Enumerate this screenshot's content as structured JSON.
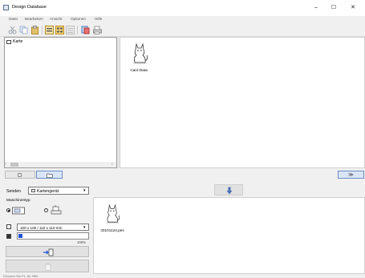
{
  "window": {
    "title": "Design Database",
    "minimize_glyph": "–",
    "maximize_glyph": "☐",
    "close_glyph": "✕"
  },
  "menu": [
    "Datei",
    "Bearbeiten",
    "Ansicht",
    "Optionen",
    "Hilfe"
  ],
  "toolbar": {
    "icons": [
      "cut-icon",
      "copy-icon",
      "paste-icon",
      "large-icons-view-icon",
      "small-icons-view-icon",
      "list-view-icon",
      "design-library-icon",
      "print-icon"
    ]
  },
  "tree": {
    "items": [
      {
        "label": "Karte"
      }
    ]
  },
  "designs": [
    {
      "label": "Card Data",
      "icon": "cat-design-icon"
    }
  ],
  "tabs": {
    "collapse_glyph": "≫"
  },
  "send": {
    "label": "Senden",
    "device_value": "Kartengerät",
    "machine_type_label": "Maschinentyp",
    "frame_size_value": "100 x 100 / 110 x 110 mm",
    "progress_value": 0.06,
    "progress_label": "100%"
  },
  "send_files": [
    {
      "label": "33101124.pes",
      "icon": "cat-design-icon"
    }
  ],
  "colors": {
    "accent": "#1f54d6",
    "selection_tab": "#dae6f7"
  },
  "status": {
    "text": "Drücken Sie F1, für Hilfe"
  }
}
